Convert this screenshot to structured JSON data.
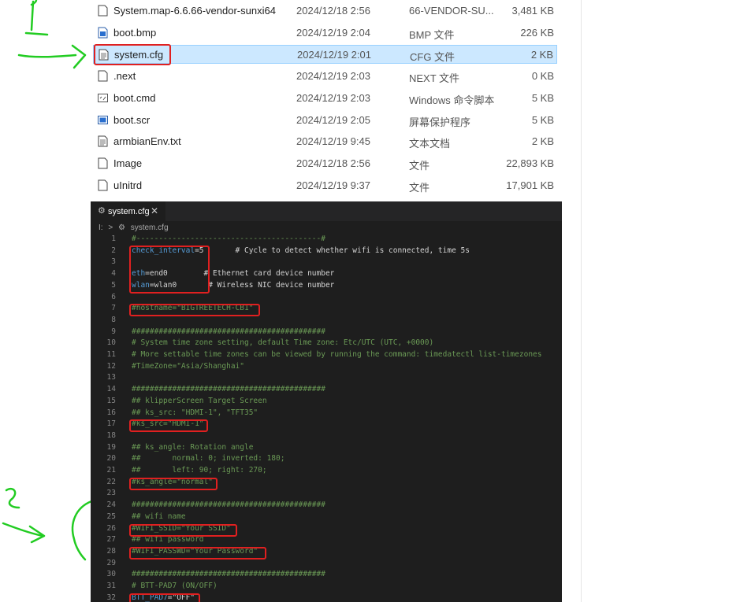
{
  "annotations": {
    "step1": "1",
    "step2": "2"
  },
  "explorer": {
    "files": [
      {
        "name": "System.map-6.6.66-vendor-sunxi64",
        "date": "2024/12/18 2:56",
        "type": "66-VENDOR-SU...",
        "size": "3,481 KB",
        "icon": "blank-file-icon"
      },
      {
        "name": "boot.bmp",
        "date": "2024/12/19 2:04",
        "type": "BMP 文件",
        "size": "226 KB",
        "icon": "image-file-icon"
      },
      {
        "name": "system.cfg",
        "date": "2024/12/19 2:01",
        "type": "CFG 文件",
        "size": "2 KB",
        "icon": "text-file-icon",
        "selected": true
      },
      {
        "name": ".next",
        "date": "2024/12/19 2:03",
        "type": "NEXT 文件",
        "size": "0 KB",
        "icon": "blank-file-icon"
      },
      {
        "name": "boot.cmd",
        "date": "2024/12/19 2:03",
        "type": "Windows 命令脚本",
        "size": "5 KB",
        "icon": "script-file-icon"
      },
      {
        "name": "boot.scr",
        "date": "2024/12/19 2:05",
        "type": "屏幕保护程序",
        "size": "5 KB",
        "icon": "screensaver-file-icon"
      },
      {
        "name": "armbianEnv.txt",
        "date": "2024/12/19 9:45",
        "type": "文本文档",
        "size": "2 KB",
        "icon": "text-file-icon"
      },
      {
        "name": "Image",
        "date": "2024/12/18 2:56",
        "type": "文件",
        "size": "22,893 KB",
        "icon": "blank-file-icon"
      },
      {
        "name": "uInitrd",
        "date": "2024/12/19 9:37",
        "type": "文件",
        "size": "17,901 KB",
        "icon": "blank-file-icon"
      }
    ]
  },
  "editor": {
    "tab_label": "system.cfg",
    "tab_close": "✕",
    "gear_glyph": "⚙",
    "breadcrumb": [
      "I:",
      ">",
      "⚙",
      "system.cfg"
    ],
    "lines": [
      {
        "n": "1",
        "k": "",
        "t": "#-----------------------------------------#",
        "c": true
      },
      {
        "n": "2",
        "k": "check_interval",
        "t": "=5       # Cycle to detect whether wifi is connected, time 5s",
        "c": false
      },
      {
        "n": "3",
        "k": "",
        "t": "",
        "c": false
      },
      {
        "n": "4",
        "k": "eth",
        "t": "=end0        # Ethernet card device number",
        "c": false
      },
      {
        "n": "5",
        "k": "wlan",
        "t": "=wlan0       # Wireless NIC device number",
        "c": false
      },
      {
        "n": "6",
        "k": "",
        "t": "",
        "c": false
      },
      {
        "n": "7",
        "k": "",
        "t": "#hostname=\"BIGTREETECH-CB1\"",
        "c": true
      },
      {
        "n": "8",
        "k": "",
        "t": "",
        "c": false
      },
      {
        "n": "9",
        "k": "",
        "t": "###########################################",
        "c": true
      },
      {
        "n": "10",
        "k": "",
        "t": "# System time zone setting, default Time zone: Etc/UTC (UTC, +0000)",
        "c": true
      },
      {
        "n": "11",
        "k": "",
        "t": "# More settable time zones can be viewed by running the command: timedatectl list-timezones",
        "c": true
      },
      {
        "n": "12",
        "k": "",
        "t": "#TimeZone=\"Asia/Shanghai\"",
        "c": true
      },
      {
        "n": "13",
        "k": "",
        "t": "",
        "c": false
      },
      {
        "n": "14",
        "k": "",
        "t": "###########################################",
        "c": true
      },
      {
        "n": "15",
        "k": "",
        "t": "## klipperScreen Target Screen",
        "c": true
      },
      {
        "n": "16",
        "k": "",
        "t": "## ks_src: \"HDMI-1\", \"TFT35\"",
        "c": true
      },
      {
        "n": "17",
        "k": "",
        "t": "#ks_src=\"HDMI-1\"",
        "c": true
      },
      {
        "n": "18",
        "k": "",
        "t": "",
        "c": false
      },
      {
        "n": "19",
        "k": "",
        "t": "## ks_angle: Rotation angle",
        "c": true
      },
      {
        "n": "20",
        "k": "",
        "t": "##       normal: 0; inverted: 180;",
        "c": true
      },
      {
        "n": "21",
        "k": "",
        "t": "##       left: 90; right: 270;",
        "c": true
      },
      {
        "n": "22",
        "k": "",
        "t": "#ks_angle=\"normal\"",
        "c": true
      },
      {
        "n": "23",
        "k": "",
        "t": "",
        "c": false
      },
      {
        "n": "24",
        "k": "",
        "t": "###########################################",
        "c": true
      },
      {
        "n": "25",
        "k": "",
        "t": "## wifi name",
        "c": true
      },
      {
        "n": "26",
        "k": "",
        "t": "#WIFI_SSID=\"Your SSID\"",
        "c": true
      },
      {
        "n": "27",
        "k": "",
        "t": "## wifi password",
        "c": true
      },
      {
        "n": "28",
        "k": "",
        "t": "#WIFI_PASSWD=\"Your Password\"",
        "c": true
      },
      {
        "n": "29",
        "k": "",
        "t": "",
        "c": false
      },
      {
        "n": "30",
        "k": "",
        "t": "###########################################",
        "c": true
      },
      {
        "n": "31",
        "k": "",
        "t": "# BTT-PAD7 (ON/OFF)",
        "c": true
      },
      {
        "n": "32",
        "k": "BTT_PAD7",
        "t": "=\"OFF\"",
        "c": false
      }
    ]
  },
  "colors": {
    "highlight": "#e02020",
    "hand_annotation": "#22cc22",
    "selection": "#cce8ff"
  }
}
